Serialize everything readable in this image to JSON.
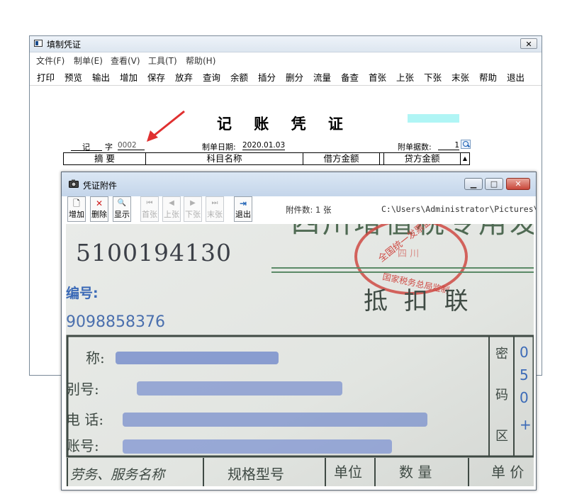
{
  "main_window": {
    "title": "填制凭证",
    "close_glyph": "✕",
    "menu": [
      "文件(F)",
      "制单(E)",
      "查看(V)",
      "工具(T)",
      "帮助(H)"
    ],
    "toolbar": [
      "打印",
      "预览",
      "输出",
      "增加",
      "保存",
      "放弃",
      "查询",
      "余额",
      "插分",
      "删分",
      "流量",
      "备查",
      "首张",
      "上张",
      "下张",
      "末张",
      "帮助",
      "退出"
    ],
    "voucher": {
      "title": "记 账 凭 证",
      "type_char": "记",
      "zi": "字",
      "number": "0002",
      "date_label": "制单日期:",
      "date": "2020.01.03",
      "attach_label": "附单据数:",
      "attach_count": "1",
      "columns": [
        "摘 要",
        "科目名称",
        "借方金额",
        "贷方金额"
      ]
    }
  },
  "attachment_window": {
    "title": "凭证附件",
    "buttons": [
      {
        "label": "增加",
        "icon": "add-page-icon",
        "glyph": "🗋",
        "enabled": true
      },
      {
        "label": "删除",
        "icon": "delete-x-icon",
        "glyph": "✕",
        "enabled": true
      },
      {
        "label": "显示",
        "icon": "view-magnifier-icon",
        "glyph": "🔍",
        "enabled": true
      },
      {
        "label": "首张",
        "icon": "first-icon",
        "glyph": "⏮",
        "enabled": false
      },
      {
        "label": "上张",
        "icon": "prev-icon",
        "glyph": "◀",
        "enabled": false
      },
      {
        "label": "下张",
        "icon": "next-icon",
        "glyph": "▶",
        "enabled": false
      },
      {
        "label": "末张",
        "icon": "last-icon",
        "glyph": "⏭",
        "enabled": false
      },
      {
        "label": "退出",
        "icon": "exit-door-icon",
        "glyph": "⇥",
        "enabled": true
      }
    ],
    "count_text": "附件数: 1 张",
    "path": "C:\\Users\\Administrator\\Pictures\\SO[",
    "minimize_glyph": "▁",
    "maximize_glyph": "□",
    "close_glyph": "✕",
    "invoice": {
      "header": "四川增值税专用发票",
      "stamp_outer": "全国统一发票监制章",
      "stamp_mid": "四 川",
      "stamp_inner": "国家税务总局监制",
      "code": "5100194130",
      "code_label": "编号:",
      "number": "9098858376",
      "deduction": "抵 扣 联",
      "rows": [
        "称:",
        "别号:",
        "电 话:",
        "账号:"
      ],
      "right_col": [
        "密",
        "码",
        "区"
      ],
      "right_digits": [
        "0",
        "5",
        "0",
        "+"
      ],
      "bottom": [
        "劳务、服务名称",
        "规格型号",
        "单位",
        "数 量",
        "单 价"
      ]
    }
  },
  "colors": {
    "accent_red": "#e03030",
    "cyan": "#b0f5f5"
  }
}
